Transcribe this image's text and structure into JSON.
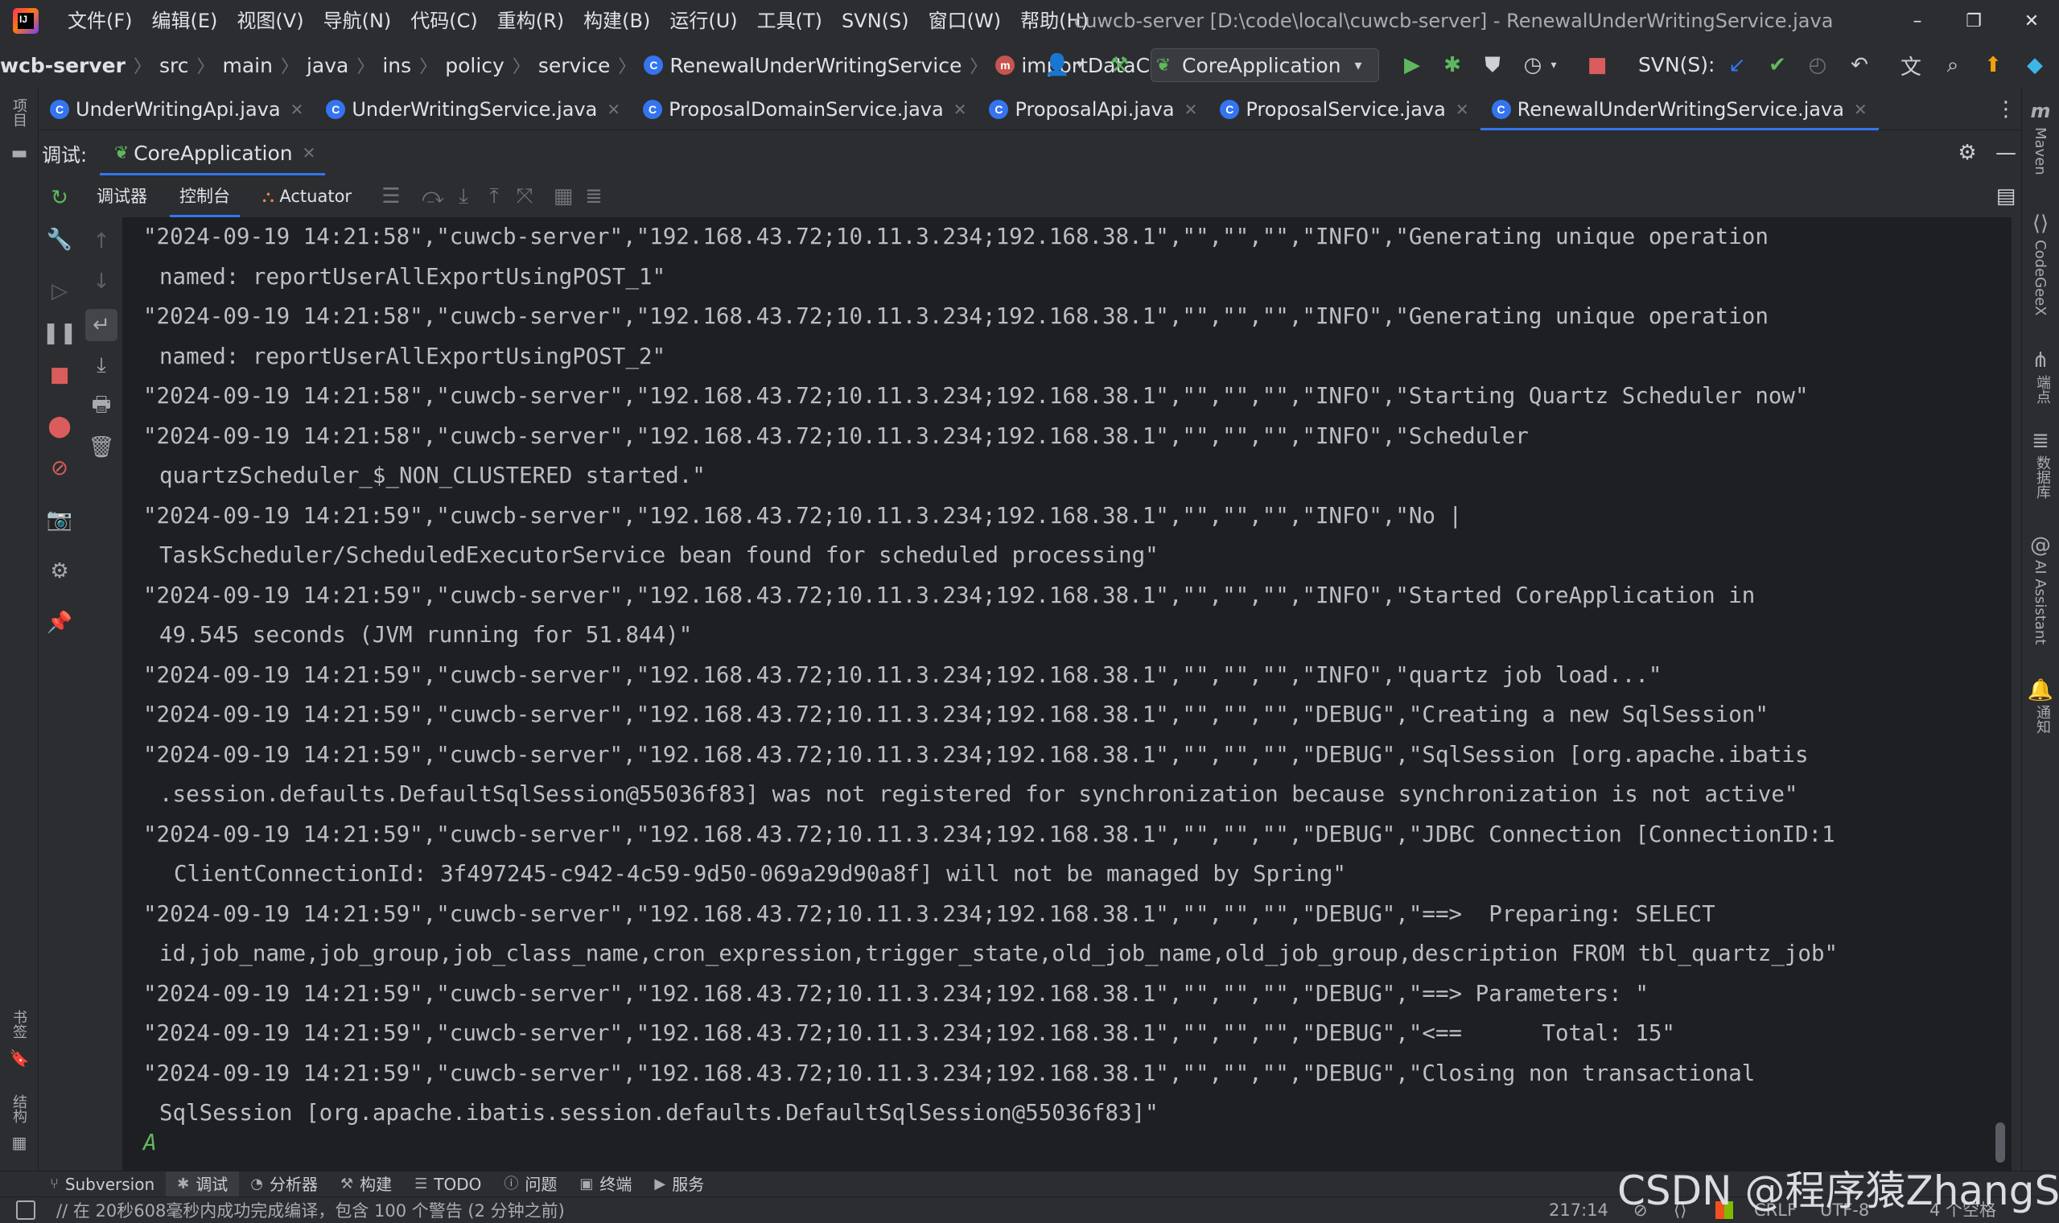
{
  "menubar": {
    "items": [
      "文件(F)",
      "编辑(E)",
      "视图(V)",
      "导航(N)",
      "代码(C)",
      "重构(R)",
      "构建(B)",
      "运行(U)",
      "工具(T)",
      "SVN(S)",
      "窗口(W)",
      "帮助(H)"
    ]
  },
  "window": {
    "title": "cuwcb-server [D:\\code\\local\\cuwcb-server] - RenewalUnderWritingService.java",
    "minimize": "–",
    "restore": "❐",
    "close": "✕"
  },
  "breadcrumb": {
    "items": [
      "wcb-server",
      "src",
      "main",
      "java",
      "ins",
      "policy",
      "service",
      "RenewalUnderWritingService",
      "importDataCheck"
    ],
    "class_icon_letter": "C",
    "method_icon_letter": "m"
  },
  "toolbar": {
    "run_config": "CoreApplication",
    "svn_label": "SVN(S):"
  },
  "editor_tabs": [
    {
      "label": "UnderWritingApi.java",
      "active": false
    },
    {
      "label": "UnderWritingService.java",
      "active": false
    },
    {
      "label": "ProposalDomainService.java",
      "active": false
    },
    {
      "label": "ProposalApi.java",
      "active": false
    },
    {
      "label": "ProposalService.java",
      "active": false
    },
    {
      "label": "RenewalUnderWritingService.java",
      "active": true
    }
  ],
  "debug": {
    "label": "调试:",
    "session": "CoreApplication",
    "subtabs": [
      "调试器",
      "控制台",
      "Actuator"
    ],
    "active_subtab": "控制台"
  },
  "console": {
    "lines": [
      {
        "text": "\"2024-09-19 14:21:58\",\"cuwcb-server\",\"192.168.43.72;10.11.3.234;192.168.38.1\",\"\",\"\",\"\",\"INFO\",\"Generating unique operation",
        "cont": 0
      },
      {
        "text": "named: reportUserAllExportUsingPOST_1\"",
        "cont": 1
      },
      {
        "text": "\"2024-09-19 14:21:58\",\"cuwcb-server\",\"192.168.43.72;10.11.3.234;192.168.38.1\",\"\",\"\",\"\",\"INFO\",\"Generating unique operation",
        "cont": 0
      },
      {
        "text": "named: reportUserAllExportUsingPOST_2\"",
        "cont": 1
      },
      {
        "text": "\"2024-09-19 14:21:58\",\"cuwcb-server\",\"192.168.43.72;10.11.3.234;192.168.38.1\",\"\",\"\",\"\",\"INFO\",\"Starting Quartz Scheduler now\"",
        "cont": 0
      },
      {
        "text": "\"2024-09-19 14:21:58\",\"cuwcb-server\",\"192.168.43.72;10.11.3.234;192.168.38.1\",\"\",\"\",\"\",\"INFO\",\"Scheduler",
        "cont": 0
      },
      {
        "text": "quartzScheduler_$_NON_CLUSTERED started.\"",
        "cont": 1
      },
      {
        "text": "\"2024-09-19 14:21:59\",\"cuwcb-server\",\"192.168.43.72;10.11.3.234;192.168.38.1\",\"\",\"\",\"\",\"INFO\",\"No |",
        "cont": 0
      },
      {
        "text": "TaskScheduler/ScheduledExecutorService bean found for scheduled processing\"",
        "cont": 1
      },
      {
        "text": "\"2024-09-19 14:21:59\",\"cuwcb-server\",\"192.168.43.72;10.11.3.234;192.168.38.1\",\"\",\"\",\"\",\"INFO\",\"Started CoreApplication in",
        "cont": 0
      },
      {
        "text": "49.545 seconds (JVM running for 51.844)\"",
        "cont": 1
      },
      {
        "text": "\"2024-09-19 14:21:59\",\"cuwcb-server\",\"192.168.43.72;10.11.3.234;192.168.38.1\",\"\",\"\",\"\",\"INFO\",\"quartz job load...\"",
        "cont": 0
      },
      {
        "text": "\"2024-09-19 14:21:59\",\"cuwcb-server\",\"192.168.43.72;10.11.3.234;192.168.38.1\",\"\",\"\",\"\",\"DEBUG\",\"Creating a new SqlSession\"",
        "cont": 0
      },
      {
        "text": "\"2024-09-19 14:21:59\",\"cuwcb-server\",\"192.168.43.72;10.11.3.234;192.168.38.1\",\"\",\"\",\"\",\"DEBUG\",\"SqlSession [org.apache.ibatis",
        "cont": 0
      },
      {
        "text": ".session.defaults.DefaultSqlSession@55036f83] was not registered for synchronization because synchronization is not active\"",
        "cont": 1
      },
      {
        "text": "\"2024-09-19 14:21:59\",\"cuwcb-server\",\"192.168.43.72;10.11.3.234;192.168.38.1\",\"\",\"\",\"\",\"DEBUG\",\"JDBC Connection [ConnectionID:1",
        "cont": 0
      },
      {
        "text": "ClientConnectionId: 3f497245-c942-4c59-9d50-069a29d90a8f] will not be managed by Spring\"",
        "cont": 2
      },
      {
        "text": "\"2024-09-19 14:21:59\",\"cuwcb-server\",\"192.168.43.72;10.11.3.234;192.168.38.1\",\"\",\"\",\"\",\"DEBUG\",\"==>  Preparing: SELECT",
        "cont": 0
      },
      {
        "text": "id,job_name,job_group,job_class_name,cron_expression,trigger_state,old_job_name,old_job_group,description FROM tbl_quartz_job\"",
        "cont": 1
      },
      {
        "text": "\"2024-09-19 14:21:59\",\"cuwcb-server\",\"192.168.43.72;10.11.3.234;192.168.38.1\",\"\",\"\",\"\",\"DEBUG\",\"==> Parameters: \"",
        "cont": 0
      },
      {
        "text": "\"2024-09-19 14:21:59\",\"cuwcb-server\",\"192.168.43.72;10.11.3.234;192.168.38.1\",\"\",\"\",\"\",\"DEBUG\",\"<==      Total: 15\"",
        "cont": 0
      },
      {
        "text": "\"2024-09-19 14:21:59\",\"cuwcb-server\",\"192.168.43.72;10.11.3.234;192.168.38.1\",\"\",\"\",\"\",\"DEBUG\",\"Closing non transactional",
        "cont": 0
      },
      {
        "text": "SqlSession [org.apache.ibatis.session.defaults.DefaultSqlSession@55036f83]\"",
        "cont": 1
      }
    ],
    "input_prompt": "A"
  },
  "left_strip": {
    "top_label": "项目",
    "bookmarks_label": "书签",
    "structure_label": "结构"
  },
  "right_strip": {
    "maven": "Maven",
    "codegeex": "CodeGeeX",
    "endpoints": "端点",
    "database": "数据库",
    "ai_assistant": "AI Assistant",
    "notifications": "通知"
  },
  "tool_windows": [
    {
      "label": "Subversion",
      "icon": "branch-icon"
    },
    {
      "label": "调试",
      "icon": "bug-icon",
      "active": true
    },
    {
      "label": "分析器",
      "icon": "profiler-icon"
    },
    {
      "label": "构建",
      "icon": "hammer-icon"
    },
    {
      "label": "TODO",
      "icon": "list-icon"
    },
    {
      "label": "问题",
      "icon": "info-icon"
    },
    {
      "label": "终端",
      "icon": "terminal-icon"
    },
    {
      "label": "服务",
      "icon": "play-icon"
    }
  ],
  "status_bar": {
    "message": "// 在 20秒608毫秒内成功完成编译，包含 100 个警告 (2 分钟之前)",
    "position": "217:14",
    "line_separator": "CRLF",
    "encoding": "UTF-8",
    "indent": "4 个空格"
  },
  "watermark": "CSDN @程序猿ZhangSir",
  "colors": {
    "accent": "#3574f0",
    "run_green": "#5fb85f",
    "stop_red": "#db5c5c",
    "console_bg": "#1e1f22",
    "panel_bg": "#2b2d30"
  }
}
